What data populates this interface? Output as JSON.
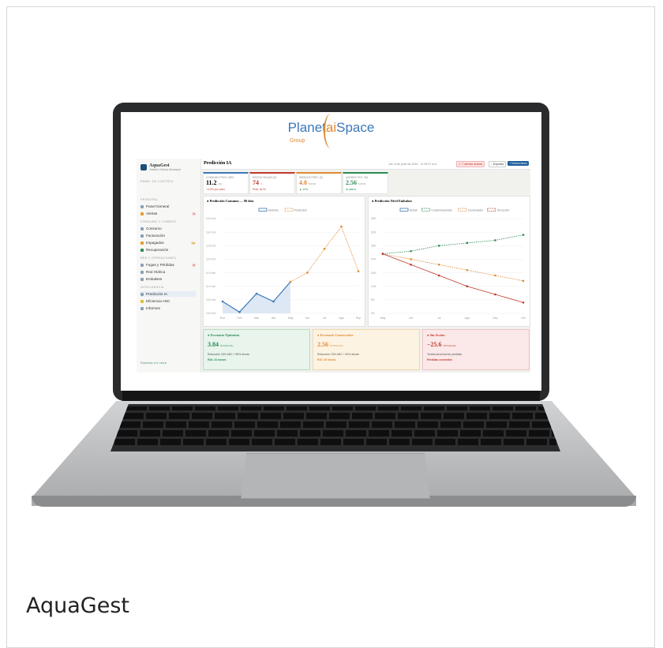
{
  "caption": "AquaGest",
  "logo": {
    "text_a": "Planet",
    "text_ai": "ai",
    "text_b": "Space",
    "group": "Group"
  },
  "app": {
    "name": "AquaGest",
    "subtitle": "Gestión Hídrica Municipal",
    "status": "PANEL DE CONTROL",
    "footer": "Sistema en línea"
  },
  "sidebar": {
    "sections": [
      {
        "title": "PRINCIPAL",
        "items": [
          {
            "label": "Panel General",
            "icon": "grid-icon"
          },
          {
            "label": "Alertas",
            "icon": "bell-icon",
            "badge": "3"
          }
        ]
      },
      {
        "title": "CONSUMO Y COBROS",
        "items": [
          {
            "label": "Consumo",
            "icon": "chart-icon"
          },
          {
            "label": "Facturación",
            "icon": "invoice-icon"
          },
          {
            "label": "Impagados",
            "icon": "warning-icon",
            "badge": "12"
          },
          {
            "label": "Recuperación",
            "icon": "refresh-icon"
          }
        ]
      },
      {
        "title": "RED Y OPERACIONES",
        "items": [
          {
            "label": "Fugas y Pérdidas",
            "icon": "search-icon",
            "badge": "5"
          },
          {
            "label": "Red Hídrica",
            "icon": "network-icon"
          },
          {
            "label": "Embalses",
            "icon": "reservoir-icon"
          }
        ]
      },
      {
        "title": "INTELIGENCIA",
        "items": [
          {
            "label": "Predicción IA",
            "icon": "ai-icon",
            "active": true
          },
          {
            "label": "Eficiencia ANC",
            "icon": "bolt-icon"
          },
          {
            "label": "Informes",
            "icon": "document-icon"
          }
        ]
      }
    ]
  },
  "topbar": {
    "title": "Predicción IA",
    "date": "Jue, 8 de junio de 2024 · 11:39:47 a.m.",
    "alerts_label": "⚠ 7 alertas activas",
    "export_label": "↓ Exportar",
    "new_task_label": "+ Nueva tarea"
  },
  "kpis": [
    {
      "label": "CONSUMO PRÓX. MES",
      "value": "11.2",
      "unit": "hm³",
      "sub": "+4.2% por calor",
      "color": "#3b78b8",
      "sub_color": "#c0392b"
    },
    {
      "label": "RIESGO SEQUÍA Q3",
      "value": "74",
      "unit": "%",
      "sub": "Prob. ALTA",
      "color": "#c0392b",
      "sub_color": "#c0392b"
    },
    {
      "label": "IMPAGOS PREV. Q3",
      "value": "4.8",
      "unit": "M EUR",
      "sub": "▲ 14%",
      "color": "#e08a33",
      "sub_color": "#2e8b57"
    },
    {
      "label": "AHORRO POT. VÍA",
      "value": "2.56",
      "unit": "M EUR",
      "sub": "IA activa",
      "color": "#2e8b57",
      "sub_color": "#2e8b57"
    }
  ],
  "panel_consumo": {
    "title": "● Predicción Consumo — 90 días",
    "legend": [
      "Histórico",
      "Predicción"
    ]
  },
  "panel_embalses": {
    "title": "● Predicción Nivel Embalses",
    "legend": [
      "Actual",
      "Conservacionista",
      "Conservador",
      "Sin acción"
    ]
  },
  "chart_data": [
    {
      "type": "line",
      "title": "Predicción Consumo — 90 días",
      "categories": [
        "Ene",
        "Feb",
        "Mar",
        "Abr",
        "May",
        "Jun",
        "Jul",
        "Ago",
        "Sep"
      ],
      "ytick_labels": [
        "10.0 hm³",
        "10.5 hm³",
        "11.0 hm³",
        "11.5 hm³",
        "12.0 hm³",
        "12.5 hm³",
        "13.0 hm³",
        "13.5 hm³"
      ],
      "ylim": [
        10.0,
        13.6
      ],
      "series": [
        {
          "name": "Histórico",
          "x": [
            0,
            1,
            2,
            3,
            4
          ],
          "values": [
            10.45,
            10.05,
            10.75,
            10.45,
            11.2
          ],
          "color": "#3b78b8"
        },
        {
          "name": "Predicción",
          "x": [
            4,
            5,
            6,
            7,
            8
          ],
          "values": [
            11.2,
            11.55,
            12.45,
            13.3,
            11.6
          ],
          "color": "#e08a33"
        }
      ]
    },
    {
      "type": "line",
      "title": "Predicción Nivel Embalses",
      "categories": [
        "May",
        "Jun",
        "Jul",
        "Ago",
        "Sep",
        "Oct"
      ],
      "ytick_labels": [
        "0%",
        "5%",
        "10%",
        "15%",
        "20%",
        "25%",
        "30%",
        "35%"
      ],
      "ylim": [
        0,
        35
      ],
      "series": [
        {
          "name": "Actual",
          "values": [
            22,
            null,
            null,
            null,
            null,
            null
          ],
          "color": "#3b78b8"
        },
        {
          "name": "Conservacionista",
          "values": [
            22,
            23,
            25,
            26,
            27,
            29
          ],
          "color": "#2e8b57"
        },
        {
          "name": "Conservador",
          "values": [
            22,
            20,
            18,
            16,
            14,
            12
          ],
          "color": "#e08a33"
        },
        {
          "name": "Sin acción",
          "values": [
            22,
            18,
            14,
            10,
            7,
            4
          ],
          "color": "#c0392b"
        }
      ]
    }
  ],
  "scenarios": [
    {
      "title": "● Escenario Optimista",
      "value": "3.84",
      "unit": "M EUR/año",
      "desc": "Reducción 15% ANC + 80% deuda",
      "result": "ROI: 24 meses",
      "color": "#2e8b57",
      "bg": "#e8f4ec",
      "border": "#b9dcc4"
    },
    {
      "title": "● Escenario Conservador",
      "value": "2.56",
      "unit": "M EUR/año",
      "desc": "Reducción 10% ANC + 60% deuda",
      "result": "ROI: 30 meses",
      "color": "#e08a33",
      "bg": "#fdf3e2",
      "border": "#f0d6a8"
    },
    {
      "title": "● Sin Acción",
      "value": "−25.6",
      "unit": "M EUR/año",
      "desc": "Tendencia actual de pérdidas",
      "result": "Pérdidas crecientes",
      "color": "#c0392b",
      "bg": "#fbe9e9",
      "border": "#efc2c2"
    }
  ]
}
